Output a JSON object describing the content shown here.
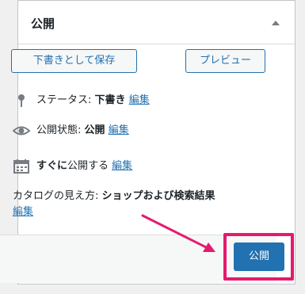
{
  "panel": {
    "title": "公開"
  },
  "buttons": {
    "save_draft": "下書きとして保存",
    "preview": "プレビュー",
    "publish": "公開"
  },
  "status": {
    "label": "ステータス:",
    "value": "下書き",
    "edit": "編集",
    "icon": "pin-icon"
  },
  "visibility": {
    "label": "公開状態:",
    "value": "公開",
    "edit": "編集",
    "icon": "eye-icon"
  },
  "schedule": {
    "prefix_bold": "すぐに",
    "suffix": "公開する",
    "edit": "編集",
    "icon": "calendar-icon"
  },
  "catalog": {
    "label": "カタログの見え方:",
    "value": "ショップおよび検索結果",
    "edit": "編集"
  },
  "colors": {
    "accent": "#2271b1",
    "highlight": "#e6196e"
  }
}
